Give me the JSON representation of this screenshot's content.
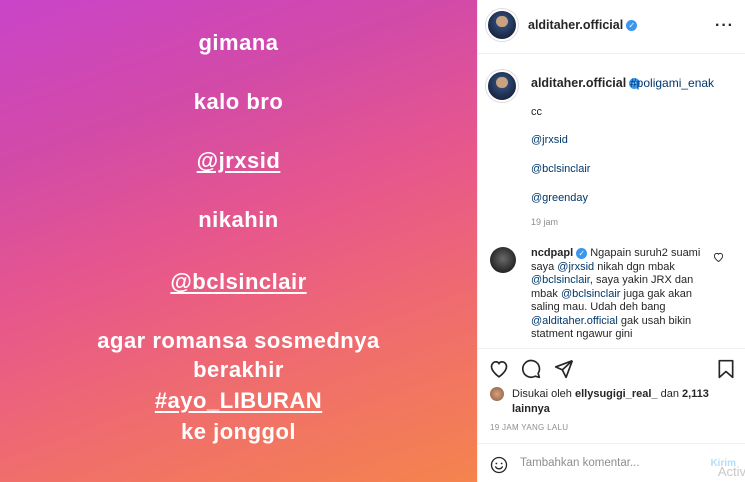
{
  "story_image": {
    "lines": [
      "gimana",
      "kalo bro",
      "@jrxsid",
      "nikahin",
      "@bclsinclair",
      "agar romansa sosmednya",
      "berakhir",
      "#ayo_LIBURAN",
      "ke jonggol"
    ]
  },
  "header": {
    "username": "alditaher.official",
    "more_icon": "more-dots-icon"
  },
  "caption": {
    "username": "alditaher.official",
    "hashtag": "#poligami_enak",
    "lines": [
      "cc",
      "@jrxsid",
      "@bclsinclair",
      "@greenday"
    ],
    "time": "19 jam"
  },
  "comment": {
    "username": "ncdpapl",
    "text_parts": [
      " Ngapain suruh2 suami saya ",
      "@jrxsid",
      " nikah dgn mbak ",
      "@bclsinclair",
      ", saya yakin JRX dan mbak ",
      "@bclsinclair",
      " juga gak akan saling mau. Udah deh bang ",
      "@alditaher.official",
      " gak usah bikin statment ngawur gini"
    ]
  },
  "likes": {
    "prefix": "Disukai oleh ",
    "user": "ellysugigi_real_",
    "middle": " dan ",
    "count": "2,113 lainnya"
  },
  "post_time": "19 JAM YANG LALU",
  "comment_box": {
    "placeholder": "Tambahkan komentar...",
    "post_label": "Kirim"
  },
  "watermark": "Activ",
  "colors": {
    "accent": "#3897f0",
    "link": "#00376b",
    "muted": "#8e8e8e"
  }
}
